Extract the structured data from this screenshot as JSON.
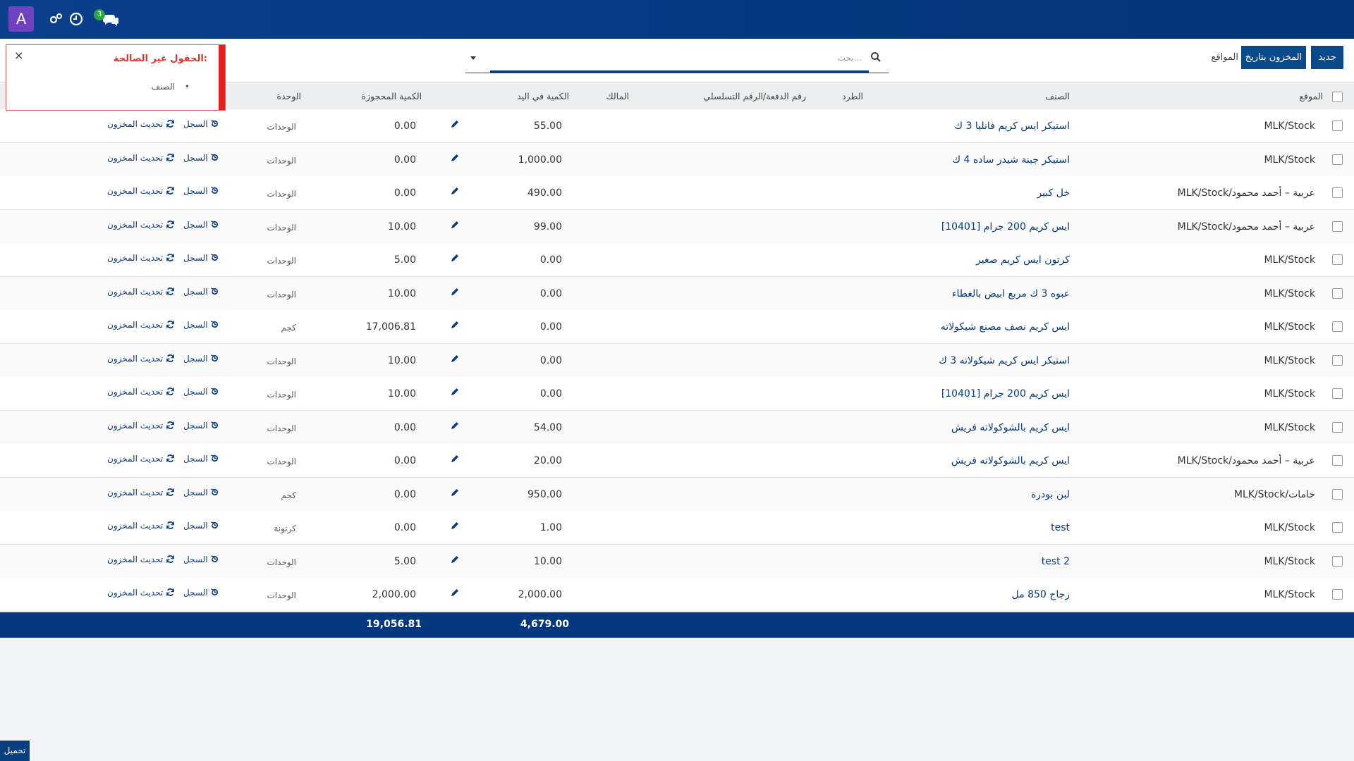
{
  "topbar": {
    "avatar_letter": "A",
    "chat_badge": "3",
    "accent": "#0b3f8c",
    "avatar_color": "#6f42c1"
  },
  "control_panel": {
    "new_button": "جديد",
    "date_button": "المخزون بتاريخ",
    "title": "المواقع",
    "search_placeholder": "بحث..."
  },
  "headers": {
    "location": "الموقع",
    "product": "الصنف",
    "package": "الطرد",
    "lot": "رقم الدفعة/الرقم التسلسلي",
    "owner": "المالك",
    "on_hand": "الكمية في اليد",
    "reserved": "الكمية المحجوزة",
    "uom": "الوحدة"
  },
  "rows": [
    {
      "location": "MLK/Stock",
      "product": "استيكر ايس كريم فانليا 3 ك",
      "qty": "55.00",
      "reserved": "0.00",
      "uom": "الوحدات"
    },
    {
      "location": "MLK/Stock",
      "product": "استيكر جبنة شيدر ساده 4 ك",
      "qty": "1,000.00",
      "reserved": "0.00",
      "uom": "الوحدات"
    },
    {
      "location": "MLK/Stock/عربية – أحمد محمود",
      "product": "خل كبير",
      "qty": "490.00",
      "reserved": "0.00",
      "uom": "الوحدات"
    },
    {
      "location": "MLK/Stock/عربية – أحمد محمود",
      "product": "[10401] ايس كريم 200 جرام",
      "qty": "99.00",
      "reserved": "10.00",
      "uom": "الوحدات"
    },
    {
      "location": "MLK/Stock",
      "product": "كرتون ايس كريم صغير",
      "qty": "0.00",
      "reserved": "5.00",
      "uom": "الوحدات"
    },
    {
      "location": "MLK/Stock",
      "product": "عبوه 3 ك مربع ابيض بالغطاء",
      "qty": "0.00",
      "reserved": "10.00",
      "uom": "الوحدات"
    },
    {
      "location": "MLK/Stock",
      "product": "ايس كريم نصف مصنع شيكولاته",
      "qty": "0.00",
      "reserved": "17,006.81",
      "uom": "كجم"
    },
    {
      "location": "MLK/Stock",
      "product": "استيكر ايس كريم شيكولاته 3 ك",
      "qty": "0.00",
      "reserved": "10.00",
      "uom": "الوحدات"
    },
    {
      "location": "MLK/Stock",
      "product": "[10401] ايس كريم 200 جرام",
      "qty": "0.00",
      "reserved": "10.00",
      "uom": "الوحدات"
    },
    {
      "location": "MLK/Stock",
      "product": "ايس كريم بالشوكولاته فريش",
      "qty": "54.00",
      "reserved": "0.00",
      "uom": "الوحدات"
    },
    {
      "location": "MLK/Stock/عربية – أحمد محمود",
      "product": "ايس كريم بالشوكولاته فريش",
      "qty": "20.00",
      "reserved": "0.00",
      "uom": "الوحدات"
    },
    {
      "location": "MLK/Stock/خامات",
      "product": "لبن بودرة",
      "qty": "950.00",
      "reserved": "0.00",
      "uom": "كجم"
    },
    {
      "location": "MLK/Stock",
      "product": "test",
      "qty": "1.00",
      "reserved": "0.00",
      "uom": "كرتونة"
    },
    {
      "location": "MLK/Stock",
      "product": "test 2",
      "qty": "10.00",
      "reserved": "5.00",
      "uom": "الوحدات"
    },
    {
      "location": "MLK/Stock",
      "product": "زجاج 850 مل",
      "qty": "2,000.00",
      "reserved": "2,000.00",
      "uom": "الوحدات"
    }
  ],
  "row_actions": {
    "history": "السجل",
    "update": "تحديث المخزون"
  },
  "totals": {
    "on_hand": "4,679.00",
    "reserved": "19,056.81"
  },
  "notification": {
    "title": "الحقول غير الصالحة:",
    "item": "الصنف",
    "close": "×",
    "color": "#e02020"
  },
  "download_button": "تحميل"
}
